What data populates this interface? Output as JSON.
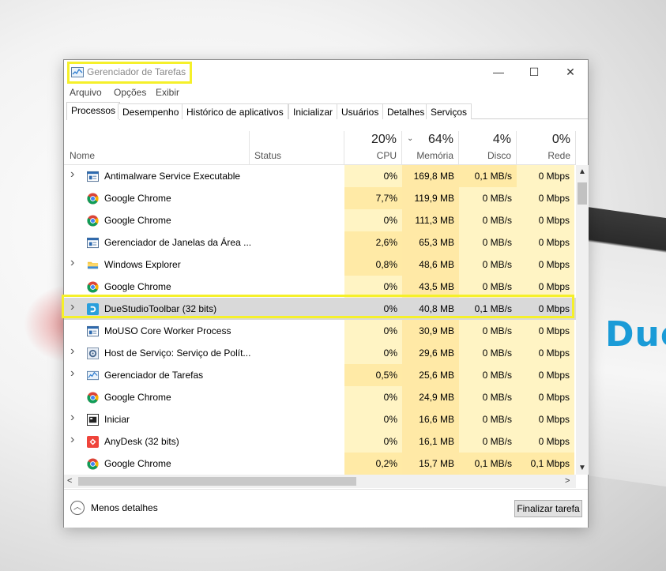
{
  "window": {
    "title": "Gerenciador de Tarefas"
  },
  "menu": [
    "Arquivo",
    "Opções",
    "Exibir"
  ],
  "tabs": [
    "Processos",
    "Desempenho",
    "Histórico de aplicativos",
    "Inicializar",
    "Usuários",
    "Detalhes",
    "Serviços"
  ],
  "columns": {
    "name": "Nome",
    "status": "Status",
    "cpu": {
      "pct": "20%",
      "label": "CPU"
    },
    "memory": {
      "pct": "64%",
      "label": "Memória"
    },
    "disk": {
      "pct": "4%",
      "label": "Disco"
    },
    "network": {
      "pct": "0%",
      "label": "Rede"
    }
  },
  "processes": [
    {
      "name": "Antimalware Service Executable",
      "icon": "shield-window-icon",
      "expandable": true,
      "cpu": "0%",
      "mem": "169,8 MB",
      "disk": "0,1 MB/s",
      "net": "0 Mbps"
    },
    {
      "name": "Google Chrome",
      "icon": "chrome-icon",
      "expandable": false,
      "cpu": "7,7%",
      "mem": "119,9 MB",
      "disk": "0 MB/s",
      "net": "0 Mbps"
    },
    {
      "name": "Google Chrome",
      "icon": "chrome-icon",
      "expandable": false,
      "cpu": "0%",
      "mem": "111,3 MB",
      "disk": "0 MB/s",
      "net": "0 Mbps"
    },
    {
      "name": "Gerenciador de Janelas da Área ...",
      "icon": "window-icon",
      "expandable": false,
      "cpu": "2,6%",
      "mem": "65,3 MB",
      "disk": "0 MB/s",
      "net": "0 Mbps"
    },
    {
      "name": "Windows Explorer",
      "icon": "folder-icon",
      "expandable": true,
      "cpu": "0,8%",
      "mem": "48,6 MB",
      "disk": "0 MB/s",
      "net": "0 Mbps"
    },
    {
      "name": "Google Chrome",
      "icon": "chrome-icon",
      "expandable": false,
      "cpu": "0%",
      "mem": "43,5 MB",
      "disk": "0 MB/s",
      "net": "0 Mbps"
    },
    {
      "name": "DueStudioToolbar (32 bits)",
      "icon": "duestudio-icon",
      "expandable": true,
      "cpu": "0%",
      "mem": "40,8 MB",
      "disk": "0,1 MB/s",
      "net": "0 Mbps",
      "selected": true
    },
    {
      "name": "MoUSO Core Worker Process",
      "icon": "window-icon",
      "expandable": false,
      "cpu": "0%",
      "mem": "30,9 MB",
      "disk": "0 MB/s",
      "net": "0 Mbps"
    },
    {
      "name": "Host de Serviço: Serviço de Polít...",
      "icon": "gear-icon",
      "expandable": true,
      "cpu": "0%",
      "mem": "29,6 MB",
      "disk": "0 MB/s",
      "net": "0 Mbps"
    },
    {
      "name": "Gerenciador de Tarefas",
      "icon": "taskmgr-icon",
      "expandable": true,
      "cpu": "0,5%",
      "mem": "25,6 MB",
      "disk": "0 MB/s",
      "net": "0 Mbps"
    },
    {
      "name": "Google Chrome",
      "icon": "chrome-icon",
      "expandable": false,
      "cpu": "0%",
      "mem": "24,9 MB",
      "disk": "0 MB/s",
      "net": "0 Mbps"
    },
    {
      "name": "Iniciar",
      "icon": "start-icon",
      "expandable": true,
      "cpu": "0%",
      "mem": "16,6 MB",
      "disk": "0 MB/s",
      "net": "0 Mbps"
    },
    {
      "name": "AnyDesk (32 bits)",
      "icon": "anydesk-icon",
      "expandable": true,
      "cpu": "0%",
      "mem": "16,1 MB",
      "disk": "0 MB/s",
      "net": "0 Mbps"
    },
    {
      "name": "Google Chrome",
      "icon": "chrome-icon",
      "expandable": false,
      "cpu": "0,2%",
      "mem": "15,7 MB",
      "disk": "0,1 MB/s",
      "net": "0,1 Mbps"
    }
  ],
  "footer": {
    "less_details": "Menos detalhes",
    "end_task": "Finalizar tarefa"
  },
  "colors": {
    "highlight": "#f5f02a",
    "cpu_col": "#fff4c4",
    "mem_col": "#ffe9a6",
    "selected_row": "#d9d9d9"
  }
}
